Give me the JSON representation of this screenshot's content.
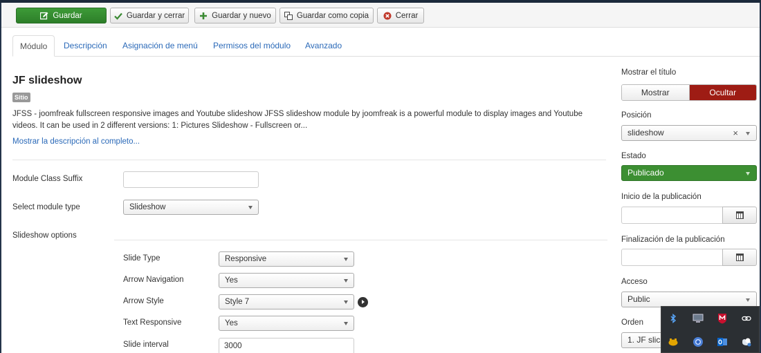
{
  "toolbar": {
    "save": "Guardar",
    "save_close": "Guardar y cerrar",
    "save_new": "Guardar y nuevo",
    "save_copy": "Guardar como copia",
    "close": "Cerrar"
  },
  "tabs": [
    "Módulo",
    "Descripción",
    "Asignación de menú",
    "Permisos del módulo",
    "Avanzado"
  ],
  "module": {
    "title": "JF slideshow",
    "badge": "Sitio",
    "description": "JFSS - joomfreak fullscreen responsive images and Youtube slideshow JFSS slideshow module by joomfreak is a powerful module to display images and Youtube videos. It can be used in 2 different versions: 1: Pictures Slideshow - Fullscreen or...",
    "show_more": "Mostrar la descripción al completo..."
  },
  "form": {
    "class_suffix_label": "Module Class Suffix",
    "class_suffix_value": "",
    "module_type_label": "Select module type",
    "module_type_value": "Slideshow",
    "slideshow_options_label": "Slideshow options",
    "slide_type_label": "Slide Type",
    "slide_type_value": "Responsive",
    "arrow_nav_label": "Arrow Navigation",
    "arrow_nav_value": "Yes",
    "arrow_style_label": "Arrow Style",
    "arrow_style_value": "Style 7",
    "text_responsive_label": "Text Responsive",
    "text_responsive_value": "Yes",
    "slide_interval_label": "Slide interval",
    "slide_interval_value": "3000"
  },
  "sidebar": {
    "show_title_label": "Mostrar el título",
    "show_option": "Mostrar",
    "hide_option": "Ocultar",
    "position_label": "Posición",
    "position_value": "slideshow",
    "state_label": "Estado",
    "state_value": "Publicado",
    "publish_start_label": "Inicio de la publicación",
    "publish_end_label": "Finalización de la publicación",
    "access_label": "Acceso",
    "access_value": "Public",
    "order_label": "Orden",
    "order_value": "1. JF slic"
  },
  "colors": {
    "save_green": "#2d7e29",
    "hide_red": "#9e1c14",
    "published_green": "#3c8f32",
    "link_blue": "#2a69b8"
  },
  "tray_icons": [
    "bluetooth-icon",
    "display-icon",
    "mcafee-icon",
    "link-icon",
    "gamepad-icon",
    "chrome-icon",
    "outlook-icon",
    "network-icon"
  ]
}
